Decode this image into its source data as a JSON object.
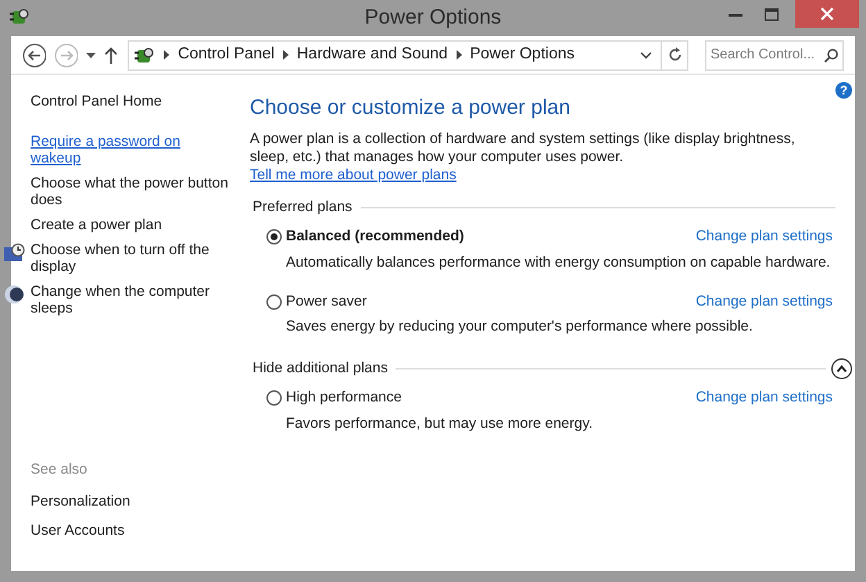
{
  "window": {
    "title": "Power Options"
  },
  "address_bar": {
    "crumbs": [
      "Control Panel",
      "Hardware and Sound",
      "Power Options"
    ]
  },
  "search": {
    "placeholder": "Search Control..."
  },
  "help_button": {
    "label": "?"
  },
  "sidebar": {
    "items": [
      {
        "label": "Control Panel Home",
        "kind": "text",
        "hovered": false
      },
      {
        "label": "Require a password on wakeup",
        "kind": "text",
        "hovered": true
      },
      {
        "label": "Choose what the power button does",
        "kind": "text",
        "hovered": false
      },
      {
        "label": "Create a power plan",
        "kind": "text",
        "hovered": false
      },
      {
        "label": "Choose when to turn off the display",
        "kind": "display",
        "hovered": false
      },
      {
        "label": "Change when the computer sleeps",
        "kind": "sleep",
        "hovered": false
      }
    ],
    "see_also": {
      "heading": "See also",
      "items": [
        "Personalization",
        "User Accounts"
      ]
    }
  },
  "main": {
    "title": "Choose or customize a power plan",
    "intro": "A power plan is a collection of hardware and system settings (like display brightness, sleep, etc.) that manages how your computer uses power.",
    "intro_link": "Tell me more about power plans",
    "sections": [
      {
        "heading": "Preferred plans",
        "plans": [
          {
            "name": "Balanced (recommended)",
            "selected": true,
            "description": "Automatically balances performance with energy consumption on capable hardware.",
            "link": "Change plan settings"
          },
          {
            "name": "Power saver",
            "selected": false,
            "description": "Saves energy by reducing your computer's performance where possible.",
            "link": "Change plan settings"
          }
        ]
      },
      {
        "heading": "Hide additional plans",
        "expanded": true,
        "plans": [
          {
            "name": "High performance",
            "selected": false,
            "description": "Favors performance, but may use more energy.",
            "link": "Change plan settings"
          }
        ]
      }
    ]
  }
}
